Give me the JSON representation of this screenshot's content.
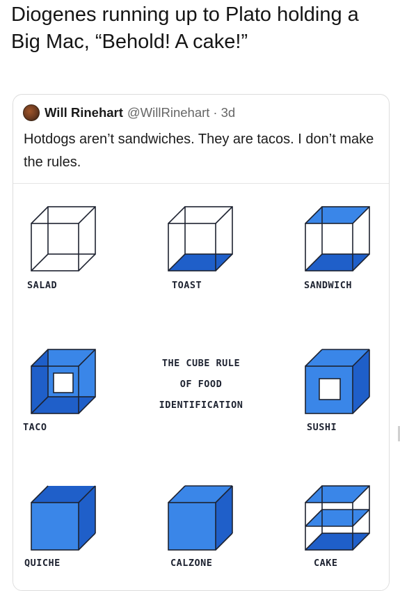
{
  "caption": "Diogenes running up to Plato holding a Big Mac, “Behold! A cake!”",
  "tweet": {
    "avatar_icon": "profile-avatar",
    "name": "Will Rinehart",
    "handle": "@WillRinehart",
    "separator": "·",
    "time": "3d",
    "text": "Hotdogs aren’t sandwiches. They are tacos. I don’t make the rules."
  },
  "figure": {
    "title_lines": [
      "THE CUBE RULE",
      "OF FOOD",
      "IDENTIFICATION"
    ],
    "fill_color": "#3a86e8",
    "dark_fill_color": "#1f5fc9",
    "line_color": "#1d2230",
    "items": [
      {
        "label": "SALAD",
        "starch_faces": []
      },
      {
        "label": "TOAST",
        "starch_faces": [
          "bottom"
        ]
      },
      {
        "label": "SANDWICH",
        "starch_faces": [
          "top",
          "bottom"
        ]
      },
      {
        "label": "TACO",
        "starch_faces": [
          "bottom",
          "left",
          "back"
        ]
      },
      {
        "label": "SUSHI",
        "starch_faces": [
          "top",
          "bottom",
          "left",
          "right"
        ]
      },
      {
        "label": "QUICHE",
        "starch_faces": [
          "bottom",
          "left",
          "right",
          "back",
          "front"
        ]
      },
      {
        "label": "CALZONE",
        "starch_faces": [
          "all"
        ]
      },
      {
        "label": "CAKE",
        "starch_faces": [
          "bottom",
          "middle",
          "top"
        ]
      }
    ]
  }
}
